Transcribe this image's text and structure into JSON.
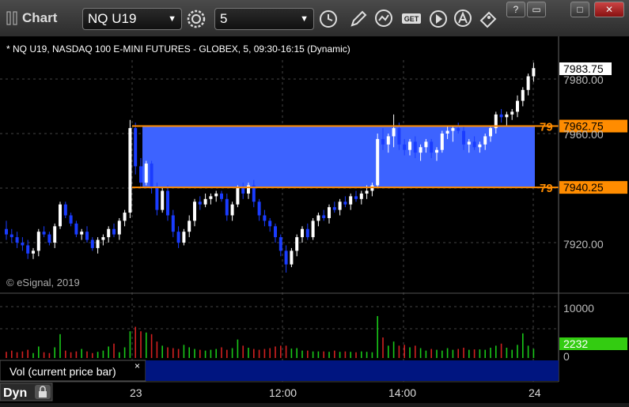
{
  "window": {
    "title": "Chart",
    "symbol": "NQ U19",
    "interval": "5",
    "buttons": [
      "minimize-icon",
      "restore-icon",
      "maximize-icon",
      "close-icon"
    ]
  },
  "chart_info": "* NQ U19, NASDAQ 100 E-MINI FUTURES - GLOBEX, 5, 09:30-16:15 (Dynamic)",
  "copyright": "© eSignal, 2019",
  "lines": [
    {
      "price": 7962.75,
      "label": "7962.75",
      "tag": "79"
    },
    {
      "price": 7940.25,
      "label": "7940.25",
      "tag": "79"
    }
  ],
  "last_price": "7983.75",
  "price_ticks": [
    "7980.00",
    "7960.00",
    "7920.00"
  ],
  "volume_ticks": [
    "10000",
    "0"
  ],
  "volume_last": "2232",
  "volume_legend": "Vol (current price bar)",
  "volume_close": "×",
  "time_labels": [
    "23",
    "12:00",
    "14:00",
    "24"
  ],
  "footer_tag": "Dyn",
  "colors": {
    "up": "#ffffff",
    "down": "#1a3cff",
    "zone": "#3d63ff",
    "level": "#ff8c00",
    "vol_up": "#19c819",
    "vol_down": "#d22020",
    "vol_badge": "#33cc11"
  },
  "chart_data": {
    "type": "candlestick",
    "title": "* NQ U19, NASDAQ 100 E-MINI FUTURES - GLOBEX, 5, 09:30-16:15 (Dynamic)",
    "ylim": [
      7900,
      7990
    ],
    "yticks": [
      7920,
      7960,
      7980
    ],
    "volume_ylim": [
      0,
      14000
    ],
    "candles": [
      [
        7925,
        7928,
        7921,
        7923
      ],
      [
        7923,
        7925,
        7920,
        7922
      ],
      [
        7922,
        7924,
        7918,
        7920
      ],
      [
        7920,
        7922,
        7917,
        7919
      ],
      [
        7919,
        7921,
        7914,
        7916
      ],
      [
        7916,
        7918,
        7914,
        7917
      ],
      [
        7917,
        7925,
        7915,
        7924
      ],
      [
        7924,
        7926,
        7922,
        7923
      ],
      [
        7923,
        7924,
        7919,
        7920
      ],
      [
        7920,
        7927,
        7918,
        7926
      ],
      [
        7926,
        7935,
        7925,
        7934
      ],
      [
        7934,
        7935,
        7929,
        7930
      ],
      [
        7930,
        7931,
        7926,
        7927
      ],
      [
        7927,
        7928,
        7922,
        7923
      ],
      [
        7923,
        7925,
        7921,
        7924
      ],
      [
        7924,
        7926,
        7920,
        7921
      ],
      [
        7921,
        7922,
        7917,
        7918
      ],
      [
        7918,
        7922,
        7916,
        7921
      ],
      [
        7921,
        7923,
        7919,
        7922
      ],
      [
        7922,
        7926,
        7920,
        7925
      ],
      [
        7925,
        7927,
        7922,
        7923
      ],
      [
        7923,
        7929,
        7921,
        7928
      ],
      [
        7928,
        7932,
        7926,
        7931
      ],
      [
        7931,
        7965,
        7929,
        7962
      ],
      [
        7962,
        7964,
        7945,
        7948
      ],
      [
        7948,
        7951,
        7940,
        7942
      ],
      [
        7942,
        7950,
        7941,
        7949
      ],
      [
        7949,
        7950,
        7938,
        7940
      ],
      [
        7940,
        7942,
        7930,
        7932
      ],
      [
        7932,
        7940,
        7931,
        7939
      ],
      [
        7939,
        7941,
        7928,
        7930
      ],
      [
        7930,
        7932,
        7922,
        7924
      ],
      [
        7924,
        7926,
        7918,
        7920
      ],
      [
        7920,
        7925,
        7919,
        7924
      ],
      [
        7924,
        7930,
        7922,
        7928
      ],
      [
        7928,
        7936,
        7926,
        7935
      ],
      [
        7935,
        7937,
        7932,
        7934
      ],
      [
        7934,
        7938,
        7933,
        7936
      ],
      [
        7936,
        7938,
        7934,
        7937
      ],
      [
        7937,
        7939,
        7935,
        7938
      ],
      [
        7938,
        7939,
        7935,
        7936
      ],
      [
        7936,
        7938,
        7928,
        7930
      ],
      [
        7930,
        7935,
        7928,
        7934
      ],
      [
        7934,
        7941,
        7933,
        7940
      ],
      [
        7940,
        7942,
        7936,
        7938
      ],
      [
        7938,
        7942,
        7936,
        7941
      ],
      [
        7941,
        7943,
        7933,
        7935
      ],
      [
        7935,
        7936,
        7928,
        7930
      ],
      [
        7930,
        7932,
        7926,
        7928
      ],
      [
        7928,
        7929,
        7924,
        7926
      ],
      [
        7926,
        7927,
        7920,
        7922
      ],
      [
        7922,
        7923,
        7915,
        7917
      ],
      [
        7917,
        7919,
        7909,
        7912
      ],
      [
        7912,
        7918,
        7911,
        7917
      ],
      [
        7917,
        7923,
        7915,
        7922
      ],
      [
        7922,
        7926,
        7920,
        7925
      ],
      [
        7925,
        7927,
        7921,
        7922
      ],
      [
        7922,
        7929,
        7921,
        7928
      ],
      [
        7928,
        7931,
        7926,
        7930
      ],
      [
        7930,
        7932,
        7928,
        7929
      ],
      [
        7929,
        7934,
        7927,
        7933
      ],
      [
        7933,
        7935,
        7931,
        7932
      ],
      [
        7932,
        7936,
        7930,
        7935
      ],
      [
        7935,
        7937,
        7933,
        7934
      ],
      [
        7934,
        7938,
        7932,
        7937
      ],
      [
        7937,
        7939,
        7935,
        7936
      ],
      [
        7936,
        7939,
        7934,
        7938
      ],
      [
        7938,
        7941,
        7936,
        7939
      ],
      [
        7939,
        7942,
        7937,
        7941
      ],
      [
        7941,
        7960,
        7940,
        7958
      ],
      [
        7958,
        7962,
        7954,
        7956
      ],
      [
        7956,
        7960,
        7953,
        7959
      ],
      [
        7959,
        7967,
        7955,
        7962
      ],
      [
        7962,
        7964,
        7954,
        7956
      ],
      [
        7956,
        7958,
        7952,
        7954
      ],
      [
        7954,
        7958,
        7952,
        7957
      ],
      [
        7957,
        7959,
        7951,
        7953
      ],
      [
        7953,
        7956,
        7950,
        7955
      ],
      [
        7955,
        7958,
        7953,
        7957
      ],
      [
        7957,
        7958,
        7951,
        7953
      ],
      [
        7953,
        7955,
        7950,
        7954
      ],
      [
        7954,
        7961,
        7953,
        7960
      ],
      [
        7960,
        7963,
        7958,
        7961
      ],
      [
        7961,
        7963,
        7957,
        7962
      ],
      [
        7962,
        7964,
        7960,
        7961
      ],
      [
        7961,
        7963,
        7954,
        7956
      ],
      [
        7956,
        7958,
        7953,
        7957
      ],
      [
        7957,
        7959,
        7954,
        7955
      ],
      [
        7955,
        7957,
        7953,
        7956
      ],
      [
        7956,
        7960,
        7954,
        7959
      ],
      [
        7959,
        7963,
        7957,
        7962
      ],
      [
        7962,
        7968,
        7960,
        7967
      ],
      [
        7967,
        7969,
        7964,
        7966
      ],
      [
        7966,
        7968,
        7963,
        7967
      ],
      [
        7967,
        7969,
        7965,
        7968
      ],
      [
        7968,
        7974,
        7966,
        7972
      ],
      [
        7972,
        7977,
        7970,
        7976
      ],
      [
        7976,
        7982,
        7974,
        7981
      ],
      [
        7981,
        7986,
        7979,
        7984
      ]
    ],
    "volume": [
      1500,
      1800,
      1400,
      1600,
      2000,
      1200,
      2800,
      1400,
      1200,
      2600,
      5800,
      1800,
      1400,
      1600,
      2200,
      1600,
      1200,
      1500,
      1800,
      2800,
      3500,
      1400,
      2600,
      6500,
      7600,
      6500,
      6200,
      5800,
      4000,
      3000,
      2600,
      2400,
      2200,
      3200,
      2600,
      2200,
      2000,
      1800,
      2000,
      2200,
      2600,
      2000,
      2400,
      4500,
      3000,
      2500,
      2200,
      2000,
      2200,
      2400,
      2800,
      3000,
      3000,
      2300,
      2400,
      1800,
      1800,
      1600,
      1600,
      1600,
      1500,
      1800,
      1500,
      1600,
      1500,
      1400,
      1600,
      1500,
      1400,
      10200,
      5000,
      3000,
      4000,
      3000,
      3200,
      2600,
      3000,
      2400,
      1800,
      2200,
      2000,
      1800,
      2400,
      2000,
      2200,
      2500,
      2000,
      2100,
      2100,
      2000,
      2500,
      3000,
      3500,
      2500,
      2000,
      3200,
      6000,
      3000,
      2232
    ]
  }
}
